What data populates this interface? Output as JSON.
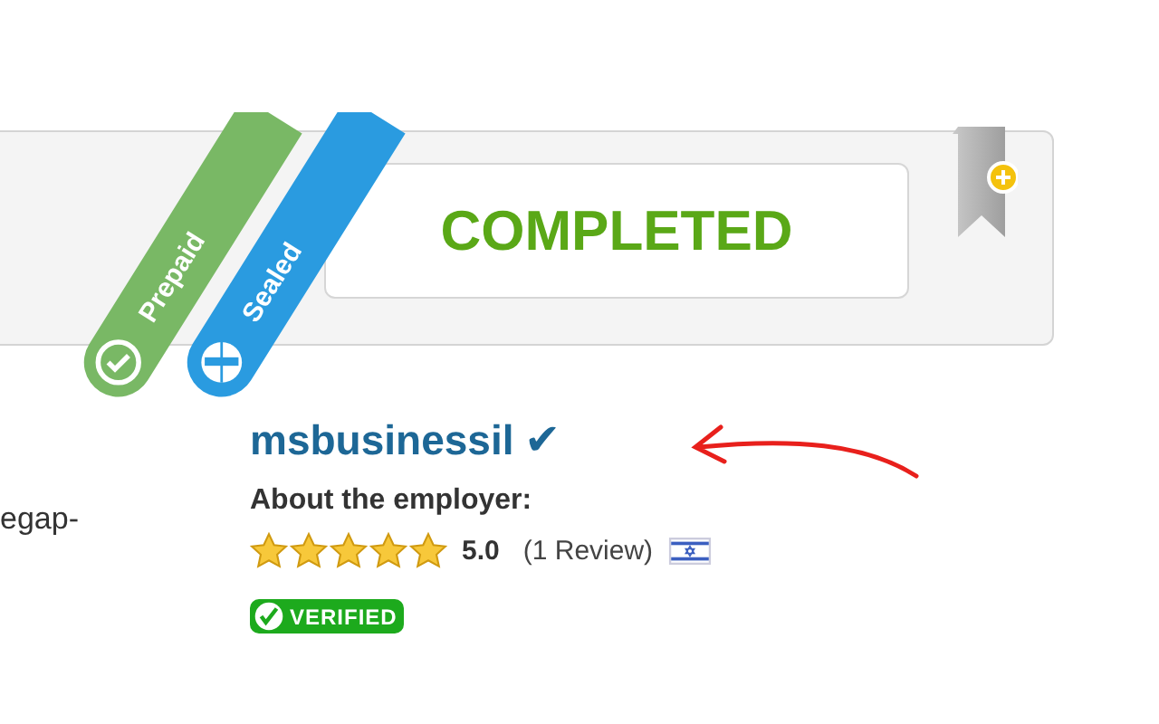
{
  "ribbons": [
    {
      "kind": "check",
      "label": "Prepaid",
      "color": "#79b865"
    },
    {
      "kind": "seal",
      "label": "Sealed",
      "color": "#2a9be0"
    }
  ],
  "status": {
    "label": "COMPLETED"
  },
  "bookmark": {
    "kind": "add"
  },
  "left_text": "egap-",
  "employer": {
    "username": "msbusinessil",
    "check": "✔",
    "about": "About the employer:",
    "stars": 5,
    "rating": "5.0",
    "reviews": "(1 Review)",
    "badge": "VERIFIED"
  }
}
